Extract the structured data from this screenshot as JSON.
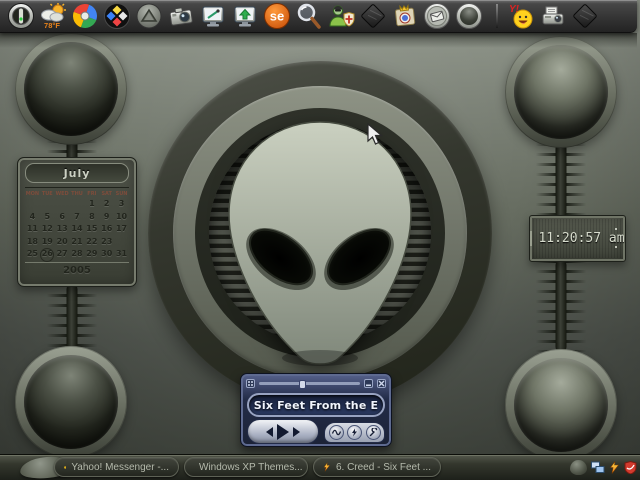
{
  "dock": {
    "weather_temp": "78°F",
    "se_label": "se",
    "yahoo_mark": "Y!",
    "left_icons": [
      "power-toggle",
      "weather",
      "color-swirl",
      "diamonds",
      "pyramid-orb",
      "camera",
      "monitor-paint",
      "monitor-upload",
      "se-logo",
      "magnifier",
      "user-shield",
      "black-diamond",
      "book-crest",
      "mail-circle",
      "blank-circle"
    ],
    "right_icons": [
      "yahoo-messenger",
      "printer-camera",
      "black-diamond"
    ]
  },
  "calendar": {
    "month": "July",
    "year": "2005",
    "selected_day": "26",
    "day_headers": [
      "MON",
      "TUE",
      "WED",
      "THU",
      "FRI",
      "SAT",
      "SUN"
    ],
    "weeks": [
      [
        "",
        "",
        "",
        "",
        "1",
        "2",
        "3"
      ],
      [
        "4",
        "5",
        "6",
        "7",
        "8",
        "9",
        "10"
      ],
      [
        "11",
        "12",
        "13",
        "14",
        "15",
        "16",
        "17"
      ],
      [
        "18",
        "19",
        "20",
        "21",
        "22",
        "23",
        ""
      ],
      [
        "25",
        "26",
        "27",
        "28",
        "29",
        "30",
        "31"
      ]
    ]
  },
  "clock": {
    "time": "11:20:57 am"
  },
  "player": {
    "track_display": "Six Feet From the E",
    "transport_buttons": [
      "previous",
      "play",
      "next"
    ],
    "aux_buttons": [
      "visualizer",
      "lightning",
      "settings"
    ],
    "slider_position": "40%"
  },
  "taskbar": {
    "ie_letter": "e",
    "tasks": [
      {
        "icon": "yahoo-smiley-icon",
        "label": "Yahoo! Messenger -..."
      },
      {
        "icon": "internet-explorer-icon",
        "label": "Windows XP Themes..."
      },
      {
        "icon": "winamp-lightning-icon",
        "label": "6. Creed - Six Feet ..."
      }
    ],
    "tray_icons": [
      "display-network-icon",
      "winamp-lightning-icon",
      "red-shield-icon"
    ]
  },
  "colors": {
    "desktop_top": "#9aa094",
    "desktop_bottom": "#434840",
    "player_navy": "#232c48",
    "display_text": "#f1f5fd",
    "taskbar_text": "#b5baac"
  }
}
